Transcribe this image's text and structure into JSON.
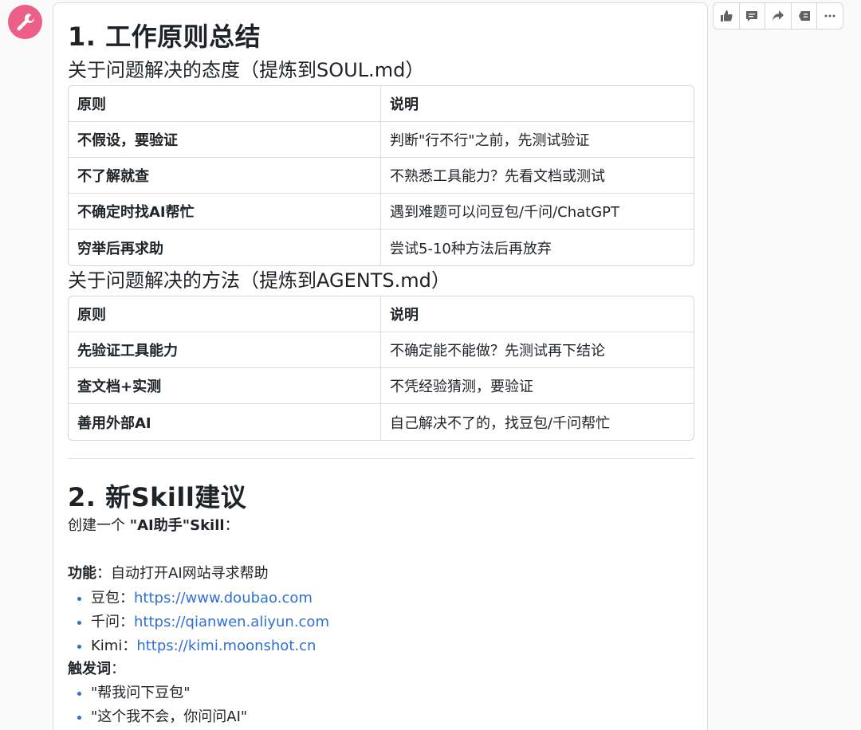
{
  "section1": {
    "title": "1. 工作原则总结",
    "sub1": "关于问题解决的态度（提炼到SOUL.md）",
    "table1": {
      "headers": [
        "原则",
        "说明"
      ],
      "rows": [
        [
          "不假设，要验证",
          "判断\"行不行\"之前，先测试验证"
        ],
        [
          "不了解就查",
          "不熟悉工具能力？先看文档或测试"
        ],
        [
          "不确定时找AI帮忙",
          "遇到难题可以问豆包/千问/ChatGPT"
        ],
        [
          "穷举后再求助",
          "尝试5-10种方法后再放弃"
        ]
      ]
    },
    "sub2": "关于问题解决的方法（提炼到AGENTS.md）",
    "table2": {
      "headers": [
        "原则",
        "说明"
      ],
      "rows": [
        [
          "先验证工具能力",
          "不确定能不能做？先测试再下结论"
        ],
        [
          "查文档+实测",
          "不凭经验猜测，要验证"
        ],
        [
          "善用外部AI",
          "自己解决不了的，找豆包/千问帮忙"
        ]
      ]
    }
  },
  "section2": {
    "title": "2. 新Skill建议",
    "intro_prefix": "创建一个 ",
    "intro_bold": "\"AI助手\"Skill",
    "intro_suffix": "：",
    "function_label": "功能",
    "function_text": "：自动打开AI网站寻求帮助",
    "sites": [
      {
        "name": "豆包：",
        "url": "https://www.doubao.com"
      },
      {
        "name": "千问：",
        "url": "https://qianwen.aliyun.com"
      },
      {
        "name": "Kimi：",
        "url": "https://kimi.moonshot.cn"
      }
    ],
    "trigger_label": "触发词",
    "trigger_suffix": "：",
    "triggers": [
      "\"帮我问下豆包\"",
      "\"这个我不会，你问问AI\""
    ]
  },
  "toolbar": [
    "thumbs-up-icon",
    "comment-icon",
    "share-icon",
    "reply-icon",
    "more-icon"
  ],
  "colors": {
    "accent": "#2f6fd6",
    "avatar": "#ec5f89"
  }
}
